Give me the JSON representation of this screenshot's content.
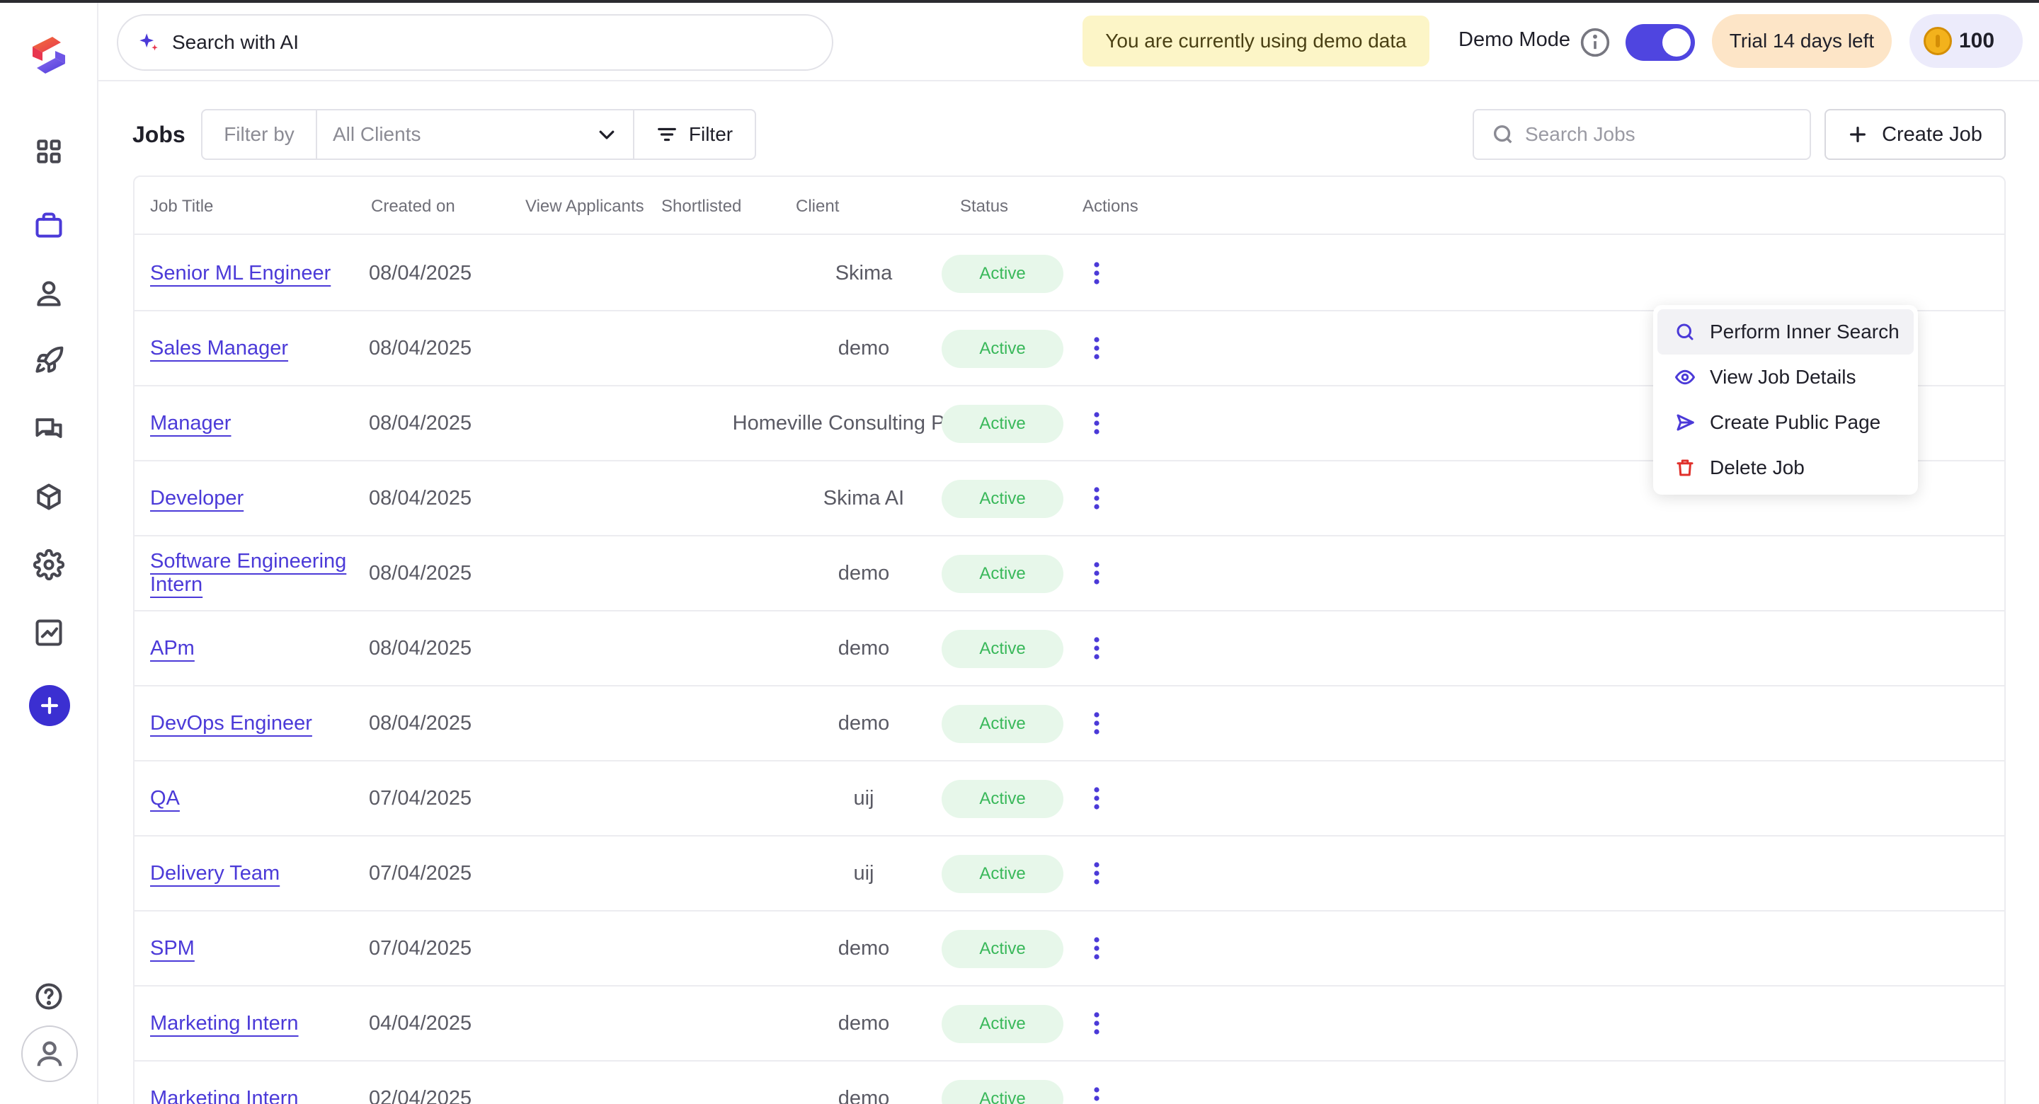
{
  "header": {
    "ai_search_label": "Search with AI",
    "demo_banner": "You are currently using demo data",
    "demo_mode_label": "Demo Mode",
    "demo_mode_on": true,
    "trial": "Trial 14 days left",
    "coins": "100"
  },
  "sidebar": {
    "items": [
      {
        "name": "dashboard-grid-icon",
        "active": false
      },
      {
        "name": "jobs-briefcase-icon",
        "active": true
      },
      {
        "name": "candidates-user-icon",
        "active": false
      },
      {
        "name": "rocket-icon",
        "active": false
      },
      {
        "name": "messages-chat-icon",
        "active": false
      },
      {
        "name": "cube-icon",
        "active": false
      },
      {
        "name": "settings-gear-icon",
        "active": false
      },
      {
        "name": "analytics-chart-icon",
        "active": false
      }
    ]
  },
  "toolbar": {
    "title": "Jobs",
    "filter_by": "Filter by",
    "clients_value": "All Clients",
    "filter_button": "Filter",
    "search_placeholder": "Search Jobs",
    "create_job": "Create Job"
  },
  "table": {
    "columns": [
      "Job Title",
      "Created on",
      "View Applicants",
      "Shortlisted",
      "Client",
      "Status",
      "Actions"
    ],
    "rows": [
      {
        "title": "Senior ML Engineer",
        "created": "08/04/2025",
        "client": "Skima",
        "status": "Active"
      },
      {
        "title": "Sales Manager",
        "created": "08/04/2025",
        "client": "demo",
        "status": "Active"
      },
      {
        "title": "Manager",
        "created": "08/04/2025",
        "client": "Homeville Consulting Pvt Ltd",
        "status": "Active"
      },
      {
        "title": "Developer",
        "created": "08/04/2025",
        "client": "Skima AI",
        "status": "Active"
      },
      {
        "title": "Software Engineering Intern",
        "created": "08/04/2025",
        "client": "demo",
        "status": "Active"
      },
      {
        "title": "APm",
        "created": "08/04/2025",
        "client": "demo",
        "status": "Active"
      },
      {
        "title": "DevOps Engineer",
        "created": "08/04/2025",
        "client": "demo",
        "status": "Active"
      },
      {
        "title": "QA",
        "created": "07/04/2025",
        "client": "uij",
        "status": "Active"
      },
      {
        "title": "Delivery Team",
        "created": "07/04/2025",
        "client": "uij",
        "status": "Active"
      },
      {
        "title": "SPM",
        "created": "07/04/2025",
        "client": "demo",
        "status": "Active"
      },
      {
        "title": "Marketing Intern",
        "created": "04/04/2025",
        "client": "demo",
        "status": "Active"
      },
      {
        "title": "Marketing Intern",
        "created": "02/04/2025",
        "client": "demo",
        "status": "Active"
      }
    ]
  },
  "actions_menu": {
    "items": [
      {
        "label": "Perform Inner Search",
        "icon": "search-icon"
      },
      {
        "label": "View Job Details",
        "icon": "eye-icon"
      },
      {
        "label": "Create Public Page",
        "icon": "send-icon"
      },
      {
        "label": "Delete Job",
        "icon": "trash-icon"
      }
    ]
  },
  "colors": {
    "accent": "#4b3ad8",
    "active_status_text": "#39b85a",
    "active_status_bg": "#e7f7ea",
    "danger": "#e0302b"
  }
}
